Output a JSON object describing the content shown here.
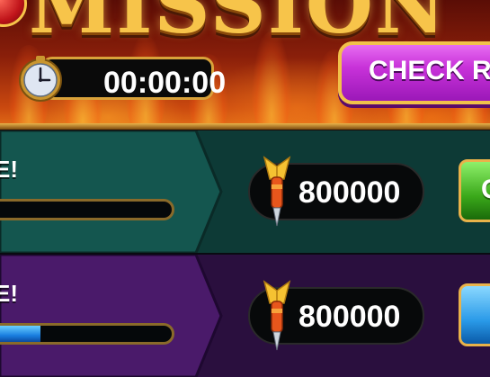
{
  "header": {
    "title": "MISSION",
    "timer": "00:00:00",
    "check_button_label": "CHECK RE"
  },
  "missions": [
    {
      "label": "E!",
      "progress": 0.0,
      "reward": "800000",
      "action_label": "C",
      "theme": "teal"
    },
    {
      "label": "E!",
      "progress": 0.3,
      "reward": "800000",
      "action_label": "",
      "theme": "purple"
    }
  ],
  "colors": {
    "header_top": "#5a0d06",
    "header_bottom": "#e06a16",
    "gold_border": "#e9b24a",
    "check_button": "#c832d9",
    "row_teal": "#0d3a36",
    "row_purple": "#2a0f3e",
    "progress_fill": "#1a7ee0",
    "action_green": "#3aa81a",
    "action_blue": "#2a9ae8"
  },
  "icons": {
    "timer": "clock-icon",
    "reward": "dart-icon"
  }
}
